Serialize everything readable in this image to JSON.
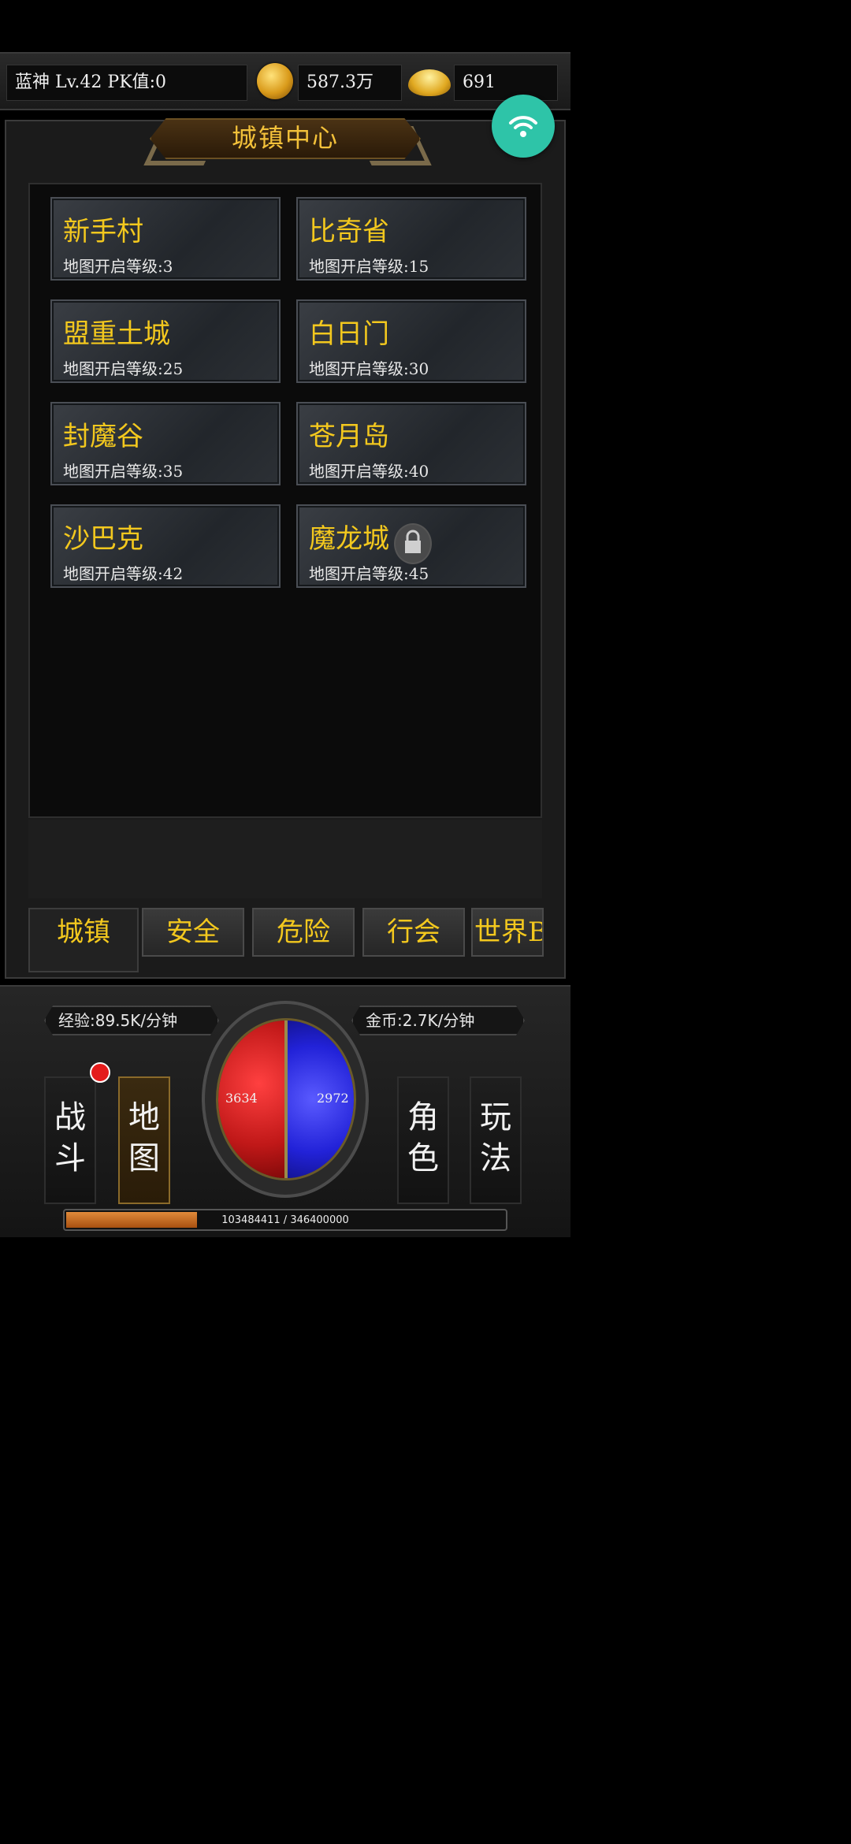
{
  "player": {
    "summary": "蓝神  Lv.42 PK值:0",
    "gold": "587.3万",
    "ingot": "691"
  },
  "panel": {
    "title": "城镇中心",
    "towns": [
      {
        "name": "新手村",
        "level": "地图开启等级:3"
      },
      {
        "name": "比奇省",
        "level": "地图开启等级:15"
      },
      {
        "name": "盟重土城",
        "level": "地图开启等级:25"
      },
      {
        "name": "白日门",
        "level": "地图开启等级:30"
      },
      {
        "name": "封魔谷",
        "level": "地图开启等级:35"
      },
      {
        "name": "苍月岛",
        "level": "地图开启等级:40"
      },
      {
        "name": "沙巴克",
        "level": "地图开启等级:42"
      },
      {
        "name": "魔龙城",
        "level": "地图开启等级:45"
      }
    ],
    "tabs": [
      "城镇",
      "安全",
      "危险",
      "行会",
      "世界B"
    ]
  },
  "hud": {
    "exp_rate": "经验:89.5K/分钟",
    "gold_rate": "金币:2.7K/分钟",
    "hp": "3634",
    "mp": "2972",
    "exp": "103484411 / 346400000",
    "exp_fraction": 0.299,
    "nav": [
      {
        "line1": "战",
        "line2": "斗"
      },
      {
        "line1": "地",
        "line2": "图"
      },
      {
        "line1": "角",
        "line2": "色"
      },
      {
        "line1": "玩",
        "line2": "法"
      }
    ]
  },
  "colors": {
    "accent_gold": "#f3c81e",
    "hp_red": "#d01c1c",
    "mp_blue": "#2222d8",
    "wifi_teal": "#2ec4a8"
  },
  "icons": [
    "gold-coin-icon",
    "gold-ingot-icon",
    "wifi-icon",
    "lock-icon",
    "notification-dot"
  ]
}
